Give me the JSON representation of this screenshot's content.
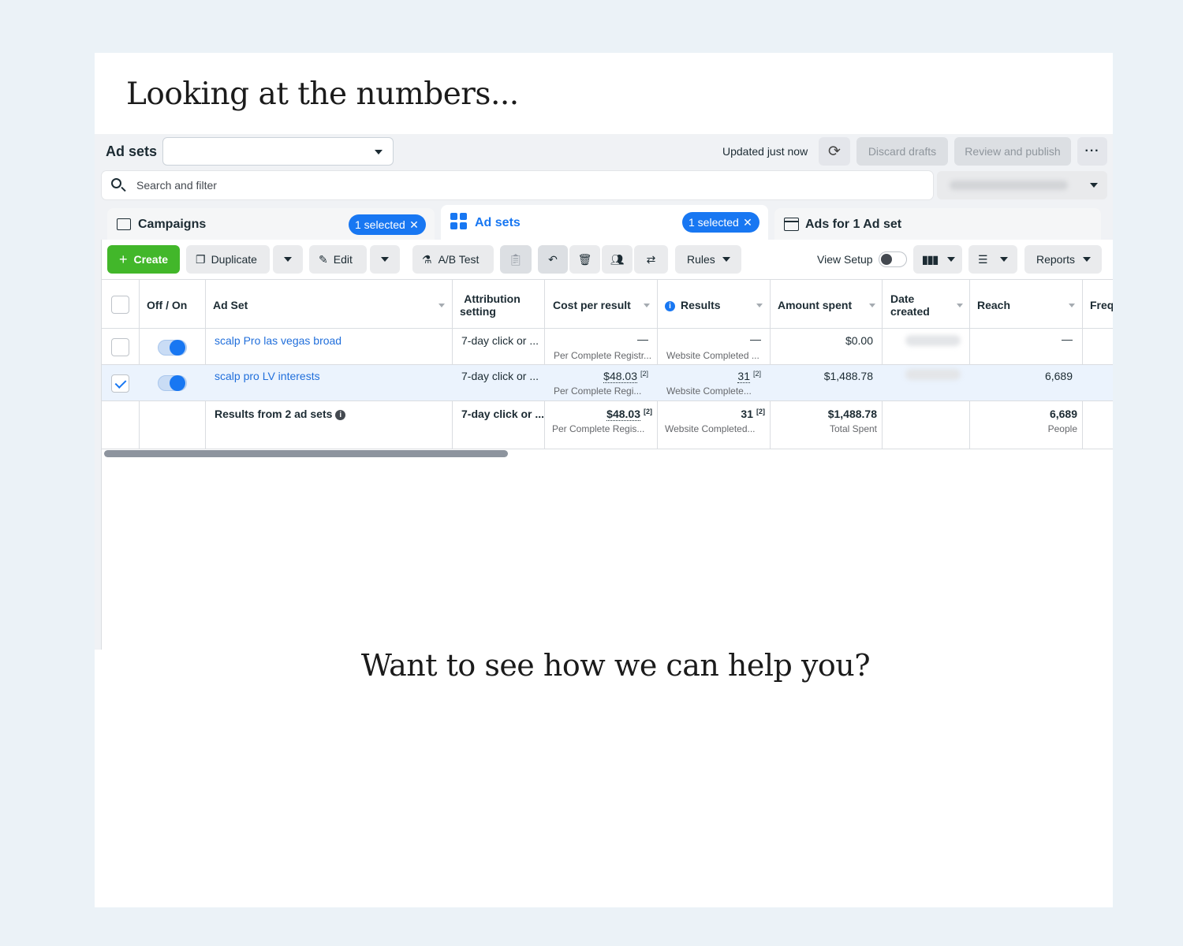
{
  "slide": {
    "headline": "Looking at the numbers...",
    "cta": "Want to see how we can help you?"
  },
  "topbar": {
    "title": "Ad sets",
    "updated": "Updated just now",
    "discard": "Discard drafts",
    "review": "Review and publish",
    "more": "···"
  },
  "search": {
    "placeholder": "Search and filter"
  },
  "tabs": [
    {
      "label": "Campaigns",
      "pill": "1 selected"
    },
    {
      "label": "Ad sets",
      "pill": "1 selected"
    },
    {
      "label": "Ads for 1 Ad set"
    }
  ],
  "toolbar": {
    "create": "Create",
    "duplicate": "Duplicate",
    "edit": "Edit",
    "abtest": "A/B Test",
    "rules": "Rules",
    "view_setup": "View Setup",
    "reports": "Reports"
  },
  "table": {
    "headers": {
      "off_on": "Off / On",
      "ad_set": "Ad Set",
      "attribution_1": "Attribution",
      "attribution_2": "setting",
      "cost": "Cost per result",
      "results": "Results",
      "amount": "Amount spent",
      "date_1": "Date",
      "date_2": "created",
      "reach": "Reach",
      "freq": "Freq"
    },
    "rows": [
      {
        "name": "scalp Pro las vegas broad",
        "attribution": "7-day click or ...",
        "cost": "—",
        "cost_sub": "Per Complete Registr...",
        "results": "—",
        "results_sub": "Website Completed ...",
        "amount": "$0.00",
        "reach": "—"
      },
      {
        "name": "scalp pro LV interests",
        "attribution": "7-day click or ...",
        "cost": "$48.03",
        "cost_ref": "[2]",
        "cost_sub": "Per Complete Regi...",
        "results": "31",
        "results_ref": "[2]",
        "results_sub": "Website Complete...",
        "amount": "$1,488.78",
        "reach": "6,689"
      }
    ],
    "summary": {
      "label": "Results from 2 ad sets",
      "attribution": "7-day click or ...",
      "cost": "$48.03",
      "cost_ref": "[2]",
      "cost_sub": "Per Complete Regis...",
      "results": "31",
      "results_ref": "[2]",
      "results_sub": "Website Completed...",
      "amount": "$1,488.78",
      "amount_sub": "Total Spent",
      "reach": "6,689",
      "reach_sub": "People"
    }
  }
}
